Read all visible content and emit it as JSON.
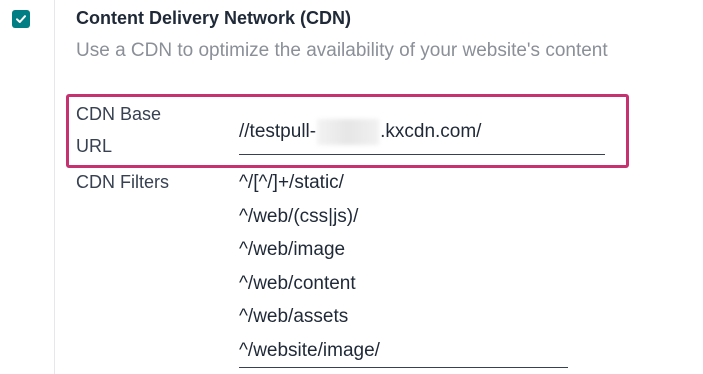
{
  "setting": {
    "checked": true,
    "title": "Content Delivery Network (CDN)",
    "description": "Use a CDN to optimize the availability of your website's content"
  },
  "cdn_base_url": {
    "label": "CDN Base URL",
    "value_prefix": "//testpull-",
    "value_suffix": ".kxcdn.com/"
  },
  "cdn_filters": {
    "label": "CDN Filters",
    "lines": [
      "^/[^/]+/static/",
      "^/web/(css|js)/",
      "^/web/image",
      "^/web/content",
      "^/web/assets",
      "^/website/image/"
    ]
  },
  "colors": {
    "checkbox": "#017e84",
    "highlight": "#c6316f"
  }
}
